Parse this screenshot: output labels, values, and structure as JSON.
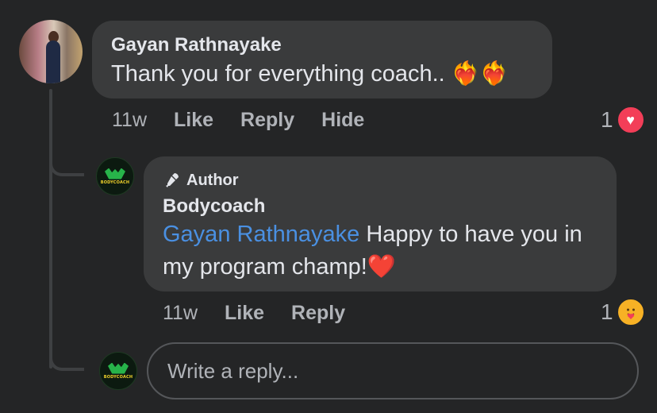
{
  "comment": {
    "author": "Gayan Rathnayake",
    "text": "Thank you for everything coach.. ",
    "emoji": "❤️‍🔥❤️‍🔥",
    "time": "11w",
    "actions": {
      "like": "Like",
      "reply": "Reply",
      "hide": "Hide"
    },
    "reaction": {
      "count": "1",
      "icon": "heart-icon",
      "color": "#f33e58"
    }
  },
  "reply": {
    "badge": "Author",
    "badge_icon": "microphone-icon",
    "author": "Bodycoach",
    "mention": "Gayan Rathnayake",
    "text_line1": " Happy to have you in",
    "text_line2": "my program champ!",
    "emoji": "❤️",
    "time": "11w",
    "actions": {
      "like": "Like",
      "reply": "Reply"
    },
    "reaction": {
      "count": "1",
      "icon": "care-face-icon",
      "color": "#f7b125"
    }
  },
  "composer": {
    "placeholder": "Write a reply..."
  },
  "avatar_logo_text": "BODYCOACH"
}
